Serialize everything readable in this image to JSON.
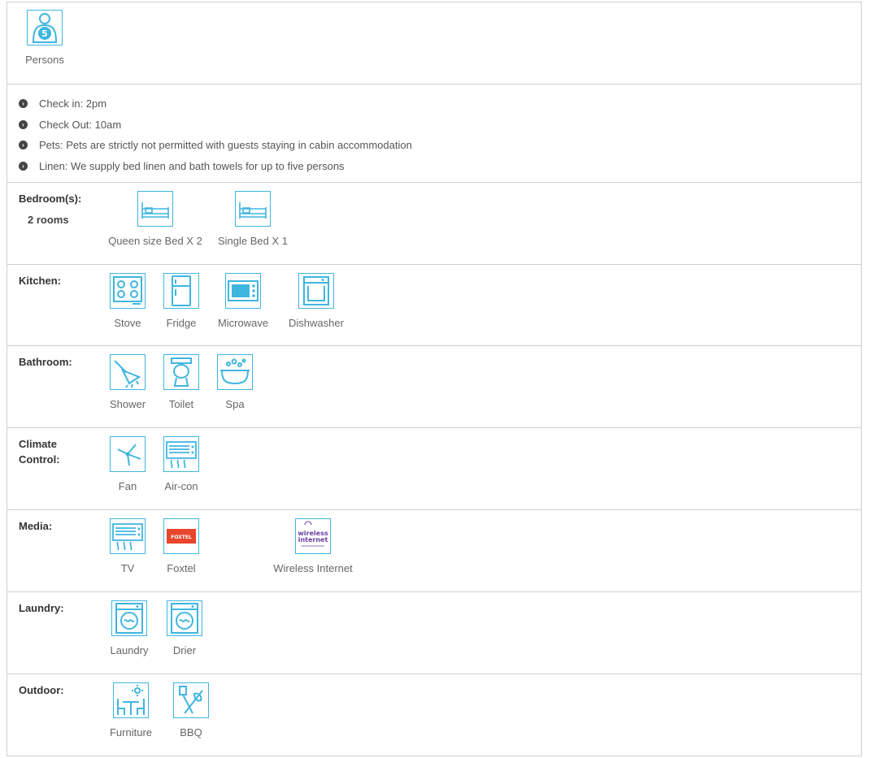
{
  "persons": {
    "count": "5",
    "label": "Persons"
  },
  "info": [
    "Check in: 2pm",
    "Check Out: 10am",
    "Pets: Pets are strictly not permitted with guests staying in cabin accommodation",
    "Linen: We supply bed linen and bath towels for up to five persons"
  ],
  "bedrooms": {
    "title": "Bedroom(s):",
    "sub": "2 rooms",
    "items": [
      "Queen size Bed X 2",
      "Single Bed X 1"
    ]
  },
  "kitchen": {
    "title": "Kitchen:",
    "items": [
      "Stove",
      "Fridge",
      "Microwave",
      "Dishwasher"
    ]
  },
  "bathroom": {
    "title": "Bathroom:",
    "items": [
      "Shower",
      "Toilet",
      "Spa"
    ]
  },
  "climate": {
    "title": "Climate Control:",
    "items": [
      "Fan",
      "Air-con"
    ]
  },
  "media": {
    "title": "Media:",
    "items": [
      "TV",
      "Foxtel",
      "Wireless Internet"
    ],
    "foxtel_logo": "FOXTEL",
    "wifi_logo": [
      "wireless",
      "internet"
    ]
  },
  "laundry": {
    "title": "Laundry:",
    "items": [
      "Laundry",
      "Drier"
    ]
  },
  "outdoor": {
    "title": "Outdoor:",
    "items": [
      "Furniture",
      "BBQ"
    ]
  },
  "colors": {
    "accent": "#3fb6e0",
    "border": "#cfcfcf",
    "foxtel": "#e8452c",
    "wifi": "#6b3fa0"
  }
}
